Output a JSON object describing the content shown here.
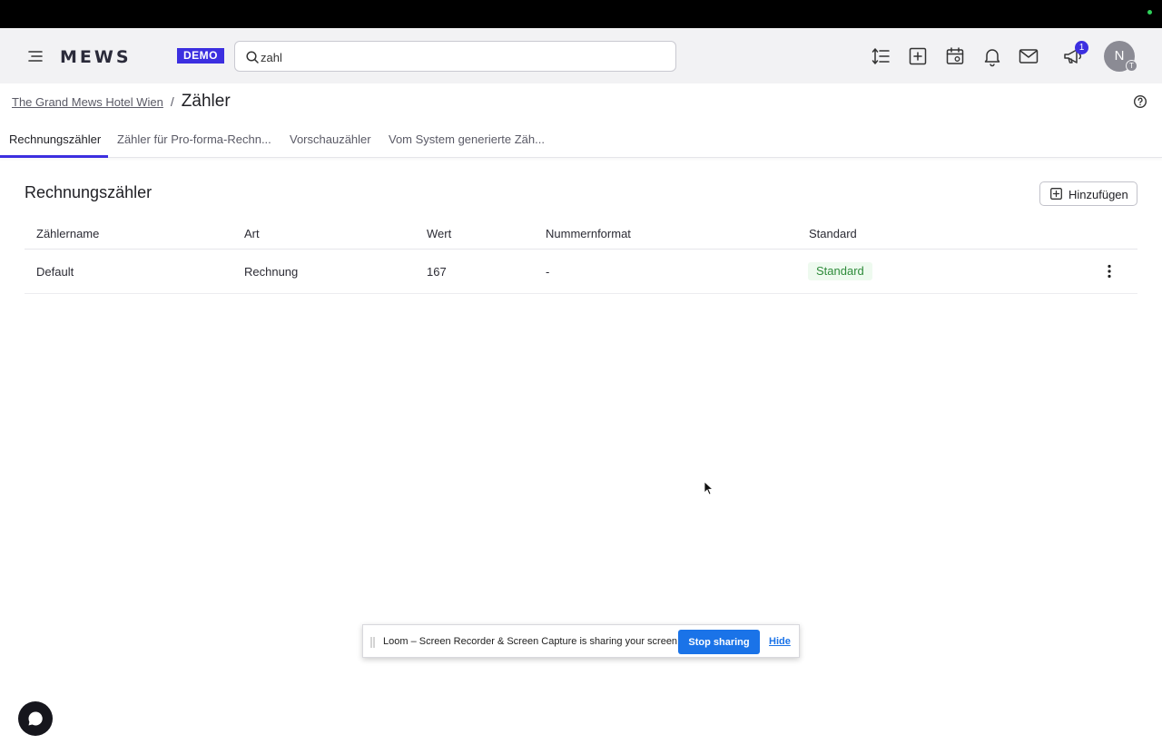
{
  "header": {
    "logo": "MEWS",
    "env_badge": "DEMO",
    "search": {
      "value": "zahl",
      "placeholder": ""
    },
    "icons": [
      "sort-icon",
      "add-square-icon",
      "calendar-icon",
      "bell-icon",
      "mail-icon",
      "megaphone-icon"
    ],
    "notification_count": "1",
    "avatar": {
      "initial": "N",
      "sub_initial": "T"
    }
  },
  "breadcrumb": {
    "parent": "The Grand Mews Hotel Wien",
    "separator": "/",
    "current": "Zähler"
  },
  "tabs": [
    {
      "label": "Rechnungszähler",
      "active": true
    },
    {
      "label": "Zähler für Pro-forma-Rechn...",
      "active": false
    },
    {
      "label": "Vorschauzähler",
      "active": false
    },
    {
      "label": "Vom System generierte Zäh...",
      "active": false
    }
  ],
  "main": {
    "title": "Rechnungszähler",
    "add_label": "Hinzufügen",
    "table": {
      "columns": [
        "Zählername",
        "Art",
        "Wert",
        "Nummernformat",
        "Standard"
      ],
      "rows": [
        {
          "name": "Default",
          "type": "Rechnung",
          "value": "167",
          "format": "-",
          "standard": "Standard"
        }
      ]
    }
  },
  "loom_bar": {
    "message": "Loom – Screen Recorder & Screen Capture is sharing your screen.",
    "stop_label": "Stop sharing",
    "hide_label": "Hide"
  },
  "colors": {
    "accent": "#3c2fe0",
    "standard_text": "#2e8b3a",
    "standard_bg": "#eefaef",
    "loom_button": "#1a73e8"
  }
}
